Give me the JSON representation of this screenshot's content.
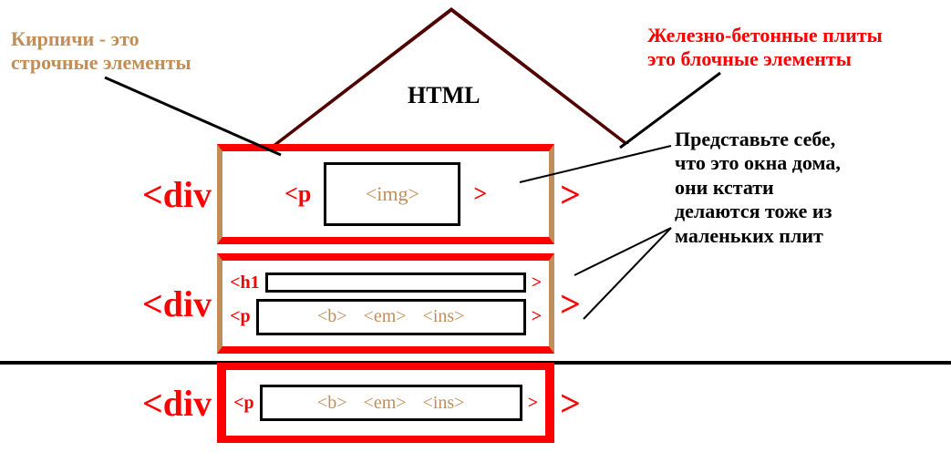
{
  "title": "HTML",
  "div_open": "<div",
  "div_close": ">",
  "row1": {
    "p_open": "<p",
    "img": "<img>",
    "p_close": ">"
  },
  "row2": {
    "h1_open": "<h1",
    "h1_close": ">",
    "p_open": "<p",
    "b": "<b>",
    "em": "<em>",
    "ins": "<ins>",
    "p_close": ">"
  },
  "row3": {
    "p_open": "<p",
    "b": "<b>",
    "em": "<em>",
    "ins": "<ins>",
    "p_close": ">"
  },
  "anno_left_l1": "Кирпичи - это",
  "anno_left_l2": "строчные элементы",
  "anno_right_l1": "Железно-бетонные плиты",
  "anno_right_l2": "это блочные элементы",
  "anno_mid_l1": "Представьте себе,",
  "anno_mid_l2": "что это окна дома,",
  "anno_mid_l3": "они кстати",
  "anno_mid_l4": "делаются тоже из",
  "anno_mid_l5": "маленьких плит"
}
